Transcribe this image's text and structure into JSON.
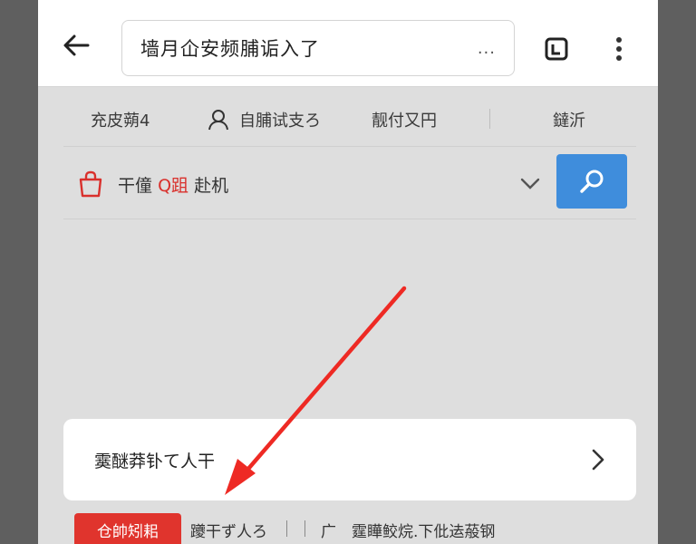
{
  "topbar": {
    "search_text": "墙月仚安频脯诟入了",
    "search_more": "..."
  },
  "nav": {
    "items": [
      {
        "label": "充皮蒴4"
      },
      {
        "label": "自脯试支ろ"
      },
      {
        "label": "靓付又円"
      },
      {
        "label": "鐽沂"
      }
    ]
  },
  "filter": {
    "text_before": "干僮",
    "text_red": "Q跙",
    "text_after": "赴机"
  },
  "card": {
    "label": "霙醚莽钋て人干"
  },
  "bottom": {
    "badge": "仓帥矧耜",
    "item1": "躨干ず人ろ",
    "item2": "广",
    "item3": "霆瞱鲛烷.下仳迲蒰钢"
  },
  "colors": {
    "accent_blue": "#3f8ddc",
    "accent_red": "#e0342d",
    "annotation_arrow": "#ee2a24"
  }
}
